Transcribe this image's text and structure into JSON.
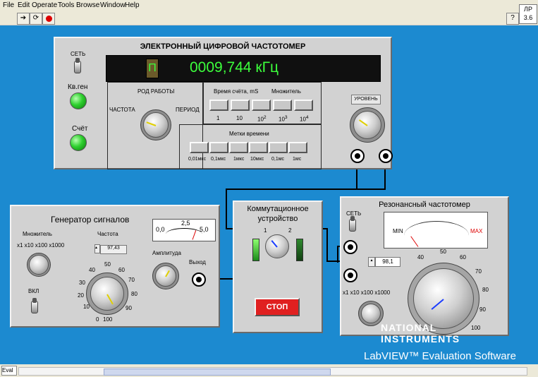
{
  "menu": [
    "File",
    "Edit",
    "Operate",
    "Tools",
    "Browse",
    "Window",
    "Help"
  ],
  "toolbar": {
    "run_icon": "run-arrow-icon",
    "run_cont_icon": "run-continuously-icon",
    "abort_icon": "abort-icon",
    "help_icon": "help-icon"
  },
  "lr_label": [
    "ЛР",
    "3.6"
  ],
  "freq_meter": {
    "title": "ЭЛЕКТРОННЫЙ ЦИФРОВОЙ ЧАСТОТОМЕР",
    "power_label": "СЕТЬ",
    "led1_label": "Кв.ген",
    "led2_label": "Счёт",
    "mode_char": "П",
    "display_value": "0009,744 кГц",
    "mode_title": "РОД РАБОТЫ",
    "mode_freq": "ЧАСТОТА",
    "mode_period": "ПЕРИОД",
    "count_time_label": "Время счёта, mS",
    "multiplier_label": "Множитель",
    "count_time_values": [
      "1",
      "10",
      "10",
      "10",
      "10"
    ],
    "count_time_sup": [
      "",
      "",
      "2",
      "3",
      "4"
    ],
    "time_marks_label": "Метки времени",
    "time_marks_values": [
      "0,01мкс",
      "0,1мкс",
      "1мкс",
      "10мкс",
      "0,1мс",
      "1мс"
    ],
    "level_label": "УРОВЕНЬ"
  },
  "generator": {
    "title": "Генератор сигналов",
    "multiplier_label": "Множитель",
    "multiplier_values": "x1 x10 x100 x1000",
    "freq_label": "Частота",
    "freq_value": "97,43",
    "on_label": "ВКЛ",
    "amp_label": "Амплитуда",
    "out_label": "Выход",
    "meter_ticks": [
      "0,0",
      "2,5",
      "5,0"
    ],
    "dial_ticks": [
      "10",
      "20",
      "30",
      "40",
      "50",
      "60",
      "70",
      "80",
      "90",
      "0",
      "100"
    ]
  },
  "switch": {
    "title_line1": "Коммутационное",
    "title_line2": "устройство",
    "pos1": "1",
    "pos2": "2",
    "stop_label": "СТОП",
    "stop_color": "#e02020"
  },
  "resonant": {
    "title": "Резонансный частотомер",
    "power_label": "СЕТЬ",
    "meter_min": "MIN",
    "meter_max": "MAX",
    "value": "98,1",
    "multiplier_values": "x1 x10 x100 x1000",
    "dial_ticks": [
      "40",
      "50",
      "60",
      "70",
      "80",
      "90",
      "100"
    ]
  },
  "watermark": {
    "line1": "NATIONAL",
    "line2": "INSTRUMENTS",
    "line3": "LabVIEW™ Evaluation Software"
  },
  "status": {
    "text": "Eval"
  },
  "colors": {
    "background": "#1c8ad0",
    "display": "#101010",
    "digits": "#3cff3c"
  }
}
